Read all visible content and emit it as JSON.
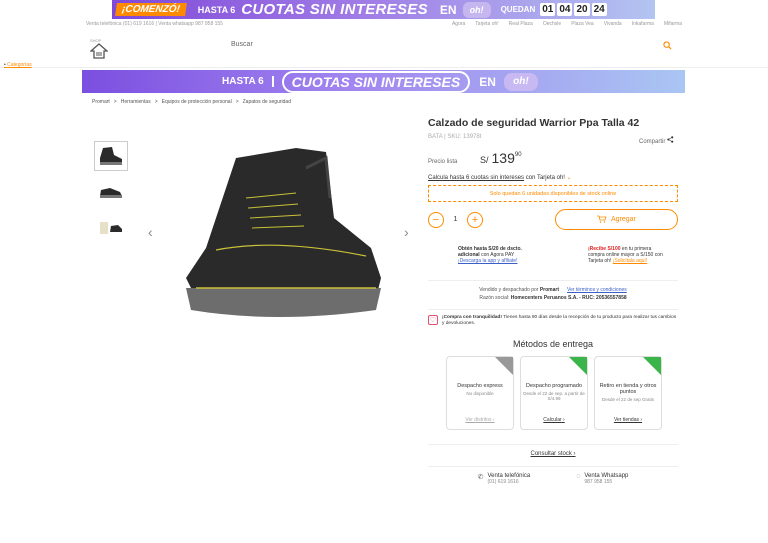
{
  "top_banner": {
    "comenzo": "¡COMENZÓ!",
    "hasta": "HASTA 6",
    "cuotas": "CUOTAS SIN INTERESES",
    "en": "EN",
    "oh": "oh!",
    "quedan": "QUEDAN",
    "countdown": [
      "01",
      "04",
      "20",
      "24"
    ]
  },
  "util_bar": {
    "left": "Venta telefónica (01) 619 1616  |  Venta whatsapp 987 958 155",
    "links": [
      "Agora",
      "Tarjeta oh!",
      "Real Plaza",
      "Oechsle",
      "Plaza Vea",
      "Vivanda",
      "Inkafarma",
      "Mifarma"
    ]
  },
  "header": {
    "logo_small": "SHOP",
    "menu_label": "Categorías",
    "search_label": "Buscar"
  },
  "promo_banner": {
    "hasta": "HASTA 6",
    "cuotas": "CUOTAS SIN INTERESES",
    "en": "EN",
    "oh": "oh!"
  },
  "breadcrumb": [
    "Promart",
    ">",
    "Herramientas",
    ">",
    "Equipos de protección personal",
    ">",
    "Zapatos de seguridad"
  ],
  "product": {
    "title": "Calzado de seguridad Warrior Ppa Talla 42",
    "brand": "BATA",
    "sku": "SKU: 13978t",
    "share": "Compartir",
    "price_label": "Precio lista",
    "currency": "S/",
    "price_int": "139",
    "price_dec": "90",
    "cuotas_link": "Calcula hasta 6 cuotas sin intereses",
    "cuotas_suffix": " con Tarjeta oh!",
    "stock": "Solo quedan 6 unidades disponibles de stock online",
    "qty": "1",
    "add_label": "Agregar"
  },
  "offers": {
    "o1_bold": "Obtén hasta S/20 de dscto. adicional",
    "o1_rest": " con Agora PAY",
    "o1_link": "¡Descarga la app y afíliate!",
    "o2_red": "¡Recibe S/100",
    "o2_rest": " en tu primera compra online mayor a S/150 con Tarjeta oh! ",
    "o2_link": "¡Solicítala aquí!"
  },
  "seller": {
    "line1_pre": "Vendido y despachado por ",
    "line1_bold": "Promart",
    "line1_link": "Ver términos y condiciones",
    "line2_pre": "Razón social: ",
    "line2_bold": "Homecenters Peruanos S.A. - RUC: 20536557858"
  },
  "guarantee": {
    "bold": "¡Compra con tranquilidad!",
    "rest": " Tienes hasta 90 días desde la recepción de tu producto para realizar tus cambios y devoluciones."
  },
  "delivery": {
    "title": "Métodos de entrega",
    "cards": [
      {
        "title": "Despacho express",
        "sub": "No disponible",
        "link": "Ver distritos",
        "corner": "gray"
      },
      {
        "title": "Despacho programado",
        "sub": "Desde el 22 de sep. a partir de S/4.99",
        "link": "Calcular",
        "corner": "green"
      },
      {
        "title": "Retiro en tienda y otros puntos",
        "sub": "Desde el 22 de sep Gratis",
        "link": "Ver tiendas",
        "corner": "green"
      }
    ],
    "consult": "Consultar stock"
  },
  "contacts": [
    {
      "title": "Venta telefónica",
      "value": "(01) 619 1616",
      "icon": "phone-icon"
    },
    {
      "title": "Venta Whatsapp",
      "value": "987 958 155",
      "icon": "whatsapp-icon"
    }
  ]
}
